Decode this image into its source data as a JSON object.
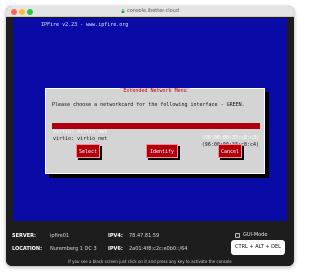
{
  "window": {
    "title": "console.ibetter.cloud"
  },
  "console": {
    "header": "IPFire v2.23 - www.ipfire.org",
    "dialog_title": "Extended Network Menu",
    "prompt": "Please choose a networkcard for the following interface - GREEN.",
    "nics": [
      {
        "name": "virtio: virtio_net",
        "mac": "(96:00:00:33:c8:c3)",
        "selected": true
      },
      {
        "name": "virtio: virtio_net",
        "mac": "(96:00:00:33:c8:c4)",
        "selected": false
      }
    ],
    "buttons": {
      "select": "Select",
      "identify": "Identify",
      "cancel": "Cancel"
    },
    "colors": {
      "screen_bg": "#0a0aa6",
      "highlight": "#b00010",
      "dialog_bg": "#d4d4d4"
    }
  },
  "info": {
    "server_label": "SERVER:",
    "server_value": "ipfire01",
    "ipv4_label": "IPV4:",
    "ipv4_value": "78.47.81.59",
    "location_label": "LOCATION:",
    "location_value": "Nuremberg 1 DC 3",
    "ipv6_label": "IPV6:",
    "ipv6_value": "2a01:4f8:c2c:e0b0::/64",
    "gui_mode_label": "GUI-Mode",
    "cad_button": "CTRL + ALT + DEL",
    "hint": "If you see a black screen just click on it and press any key to activate the console"
  }
}
